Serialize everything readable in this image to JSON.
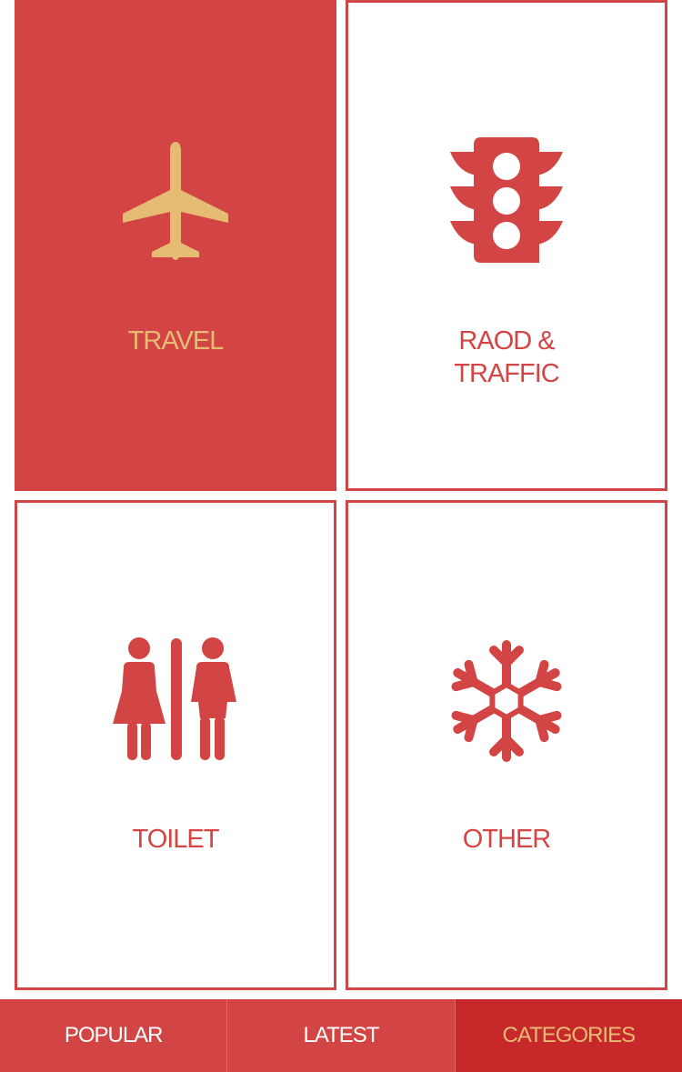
{
  "colors": {
    "accent": "#d24544",
    "accent_dark": "#c7282a",
    "gold": "#e6bb74",
    "background": "#ffffff"
  },
  "categories": [
    {
      "label": "TRAVEL",
      "icon": "airplane-icon",
      "selected": true
    },
    {
      "label_line1": "RAOD &",
      "label_line2": "TRAFFIC",
      "icon": "traffic-light-icon",
      "selected": false
    },
    {
      "label": "TOILET",
      "icon": "restroom-icon",
      "selected": false
    },
    {
      "label": "OTHER",
      "icon": "snowflake-icon",
      "selected": false
    }
  ],
  "tabbar": {
    "tabs": [
      {
        "label": "POPULAR",
        "active": false
      },
      {
        "label": "LATEST",
        "active": false
      },
      {
        "label": "CATEGORIES",
        "active": true
      }
    ]
  }
}
